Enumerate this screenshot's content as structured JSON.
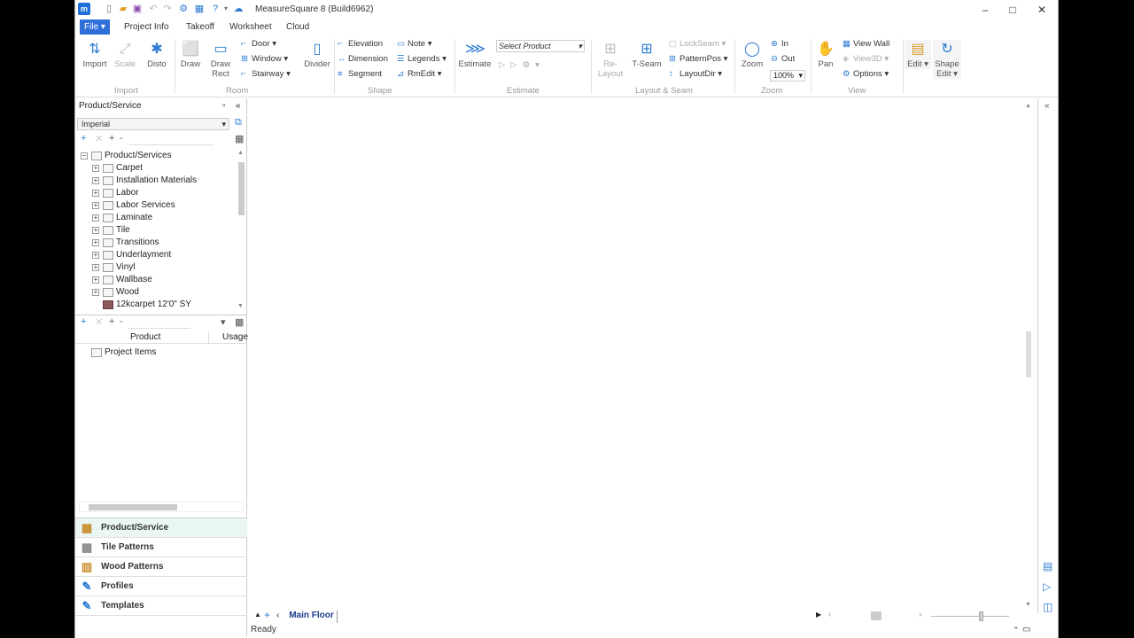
{
  "app": {
    "title": "MeasureSquare 8 (Build6962)",
    "logo": "m"
  },
  "tabs": {
    "file": "File",
    "project_info": "Project Info",
    "takeoff": "Takeoff",
    "worksheet": "Worksheet",
    "cloud": "Cloud"
  },
  "ribbon": {
    "import": {
      "import": "Import",
      "scale": "Scale",
      "disto": "Disto",
      "group": "Import"
    },
    "room": {
      "draw": "Draw",
      "draw_rect": "Draw Rect",
      "door": "Door",
      "window": "Window",
      "stairway": "Stairway",
      "divider": "Divider",
      "group": "Room"
    },
    "shape": {
      "elevation": "Elevation",
      "dimension": "Dimension",
      "segment": "Segment",
      "note": "Note",
      "legends": "Legends",
      "rmedit": "RmEdit",
      "group": "Shape"
    },
    "estimate": {
      "estimate": "Estimate",
      "select_product": "Select Product",
      "group": "Estimate"
    },
    "layout": {
      "relayout": "Re-Layout",
      "tseam": "T-Seam",
      "lockseam": "LockSeam",
      "patternpos": "PatternPos",
      "layoutdir": "LayoutDir",
      "group": "Layout & Seam"
    },
    "zoom": {
      "zoom": "Zoom",
      "in": "In",
      "out": "Out",
      "value": "100%",
      "group": "Zoom"
    },
    "view": {
      "pan": "Pan",
      "view_wall": "View Wall",
      "view3d": "View3D",
      "options": "Options",
      "group": "View"
    },
    "edit": {
      "edit": "Edit",
      "shape_edit": "Shape Edit"
    }
  },
  "panel": {
    "title": "Product/Service",
    "units": "Imperial",
    "tree": {
      "root": "Product/Services",
      "items": [
        "Carpet",
        "Installation Materials",
        "Labor",
        "Labor Services",
        "Laminate",
        "Tile",
        "Transitions",
        "Underlayment",
        "Vinyl",
        "Wallbase",
        "Wood"
      ],
      "product": "12kcarpet 12'0\" SY"
    },
    "grid": {
      "col_product": "Product",
      "col_usage": "Usage",
      "row": "Project Items"
    },
    "nav": [
      "Product/Service",
      "Tile Patterns",
      "Wood Patterns",
      "Profiles",
      "Templates"
    ]
  },
  "page": {
    "tab": "Main Floor"
  },
  "status": {
    "text": "Ready"
  },
  "colors": {
    "accent": "#2e7bd2",
    "file_tab": "#2f6fd8"
  }
}
